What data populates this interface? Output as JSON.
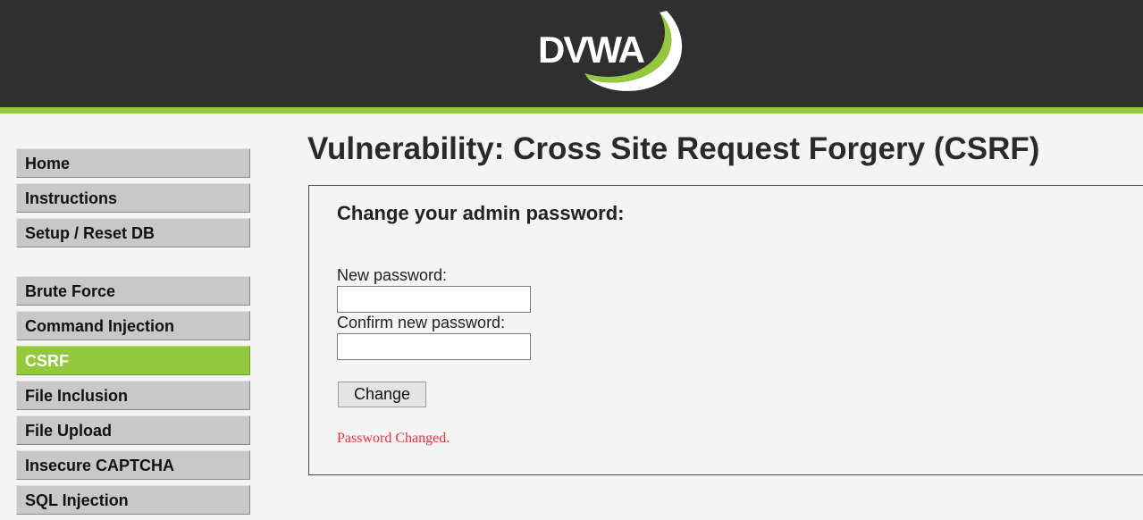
{
  "header": {
    "logo_text": "DVWA",
    "colors": {
      "background": "#2f2f2f",
      "accent": "#95c93d"
    }
  },
  "sidebar": {
    "group1": [
      {
        "label": "Home"
      },
      {
        "label": "Instructions"
      },
      {
        "label": "Setup / Reset DB"
      }
    ],
    "group2": [
      {
        "label": "Brute Force"
      },
      {
        "label": "Command Injection"
      },
      {
        "label": "CSRF",
        "active": true
      },
      {
        "label": "File Inclusion"
      },
      {
        "label": "File Upload"
      },
      {
        "label": "Insecure CAPTCHA"
      },
      {
        "label": "SQL Injection"
      }
    ]
  },
  "main": {
    "title": "Vulnerability: Cross Site Request Forgery (CSRF)",
    "form": {
      "heading": "Change your admin password:",
      "new_password_label": "New password:",
      "new_password_value": "",
      "confirm_password_label": "Confirm new password:",
      "confirm_password_value": "",
      "submit_label": "Change",
      "status_message": "Password Changed.",
      "status_color": "#e8333a"
    }
  }
}
